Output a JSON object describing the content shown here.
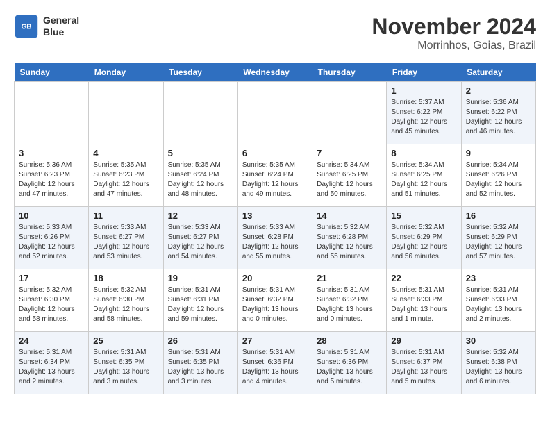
{
  "logo": {
    "line1": "General",
    "line2": "Blue"
  },
  "title": "November 2024",
  "location": "Morrinhos, Goias, Brazil",
  "weekdays": [
    "Sunday",
    "Monday",
    "Tuesday",
    "Wednesday",
    "Thursday",
    "Friday",
    "Saturday"
  ],
  "weeks": [
    [
      {
        "day": "",
        "info": ""
      },
      {
        "day": "",
        "info": ""
      },
      {
        "day": "",
        "info": ""
      },
      {
        "day": "",
        "info": ""
      },
      {
        "day": "",
        "info": ""
      },
      {
        "day": "1",
        "info": "Sunrise: 5:37 AM\nSunset: 6:22 PM\nDaylight: 12 hours and 45 minutes."
      },
      {
        "day": "2",
        "info": "Sunrise: 5:36 AM\nSunset: 6:22 PM\nDaylight: 12 hours and 46 minutes."
      }
    ],
    [
      {
        "day": "3",
        "info": "Sunrise: 5:36 AM\nSunset: 6:23 PM\nDaylight: 12 hours and 47 minutes."
      },
      {
        "day": "4",
        "info": "Sunrise: 5:35 AM\nSunset: 6:23 PM\nDaylight: 12 hours and 47 minutes."
      },
      {
        "day": "5",
        "info": "Sunrise: 5:35 AM\nSunset: 6:24 PM\nDaylight: 12 hours and 48 minutes."
      },
      {
        "day": "6",
        "info": "Sunrise: 5:35 AM\nSunset: 6:24 PM\nDaylight: 12 hours and 49 minutes."
      },
      {
        "day": "7",
        "info": "Sunrise: 5:34 AM\nSunset: 6:25 PM\nDaylight: 12 hours and 50 minutes."
      },
      {
        "day": "8",
        "info": "Sunrise: 5:34 AM\nSunset: 6:25 PM\nDaylight: 12 hours and 51 minutes."
      },
      {
        "day": "9",
        "info": "Sunrise: 5:34 AM\nSunset: 6:26 PM\nDaylight: 12 hours and 52 minutes."
      }
    ],
    [
      {
        "day": "10",
        "info": "Sunrise: 5:33 AM\nSunset: 6:26 PM\nDaylight: 12 hours and 52 minutes."
      },
      {
        "day": "11",
        "info": "Sunrise: 5:33 AM\nSunset: 6:27 PM\nDaylight: 12 hours and 53 minutes."
      },
      {
        "day": "12",
        "info": "Sunrise: 5:33 AM\nSunset: 6:27 PM\nDaylight: 12 hours and 54 minutes."
      },
      {
        "day": "13",
        "info": "Sunrise: 5:33 AM\nSunset: 6:28 PM\nDaylight: 12 hours and 55 minutes."
      },
      {
        "day": "14",
        "info": "Sunrise: 5:32 AM\nSunset: 6:28 PM\nDaylight: 12 hours and 55 minutes."
      },
      {
        "day": "15",
        "info": "Sunrise: 5:32 AM\nSunset: 6:29 PM\nDaylight: 12 hours and 56 minutes."
      },
      {
        "day": "16",
        "info": "Sunrise: 5:32 AM\nSunset: 6:29 PM\nDaylight: 12 hours and 57 minutes."
      }
    ],
    [
      {
        "day": "17",
        "info": "Sunrise: 5:32 AM\nSunset: 6:30 PM\nDaylight: 12 hours and 58 minutes."
      },
      {
        "day": "18",
        "info": "Sunrise: 5:32 AM\nSunset: 6:30 PM\nDaylight: 12 hours and 58 minutes."
      },
      {
        "day": "19",
        "info": "Sunrise: 5:31 AM\nSunset: 6:31 PM\nDaylight: 12 hours and 59 minutes."
      },
      {
        "day": "20",
        "info": "Sunrise: 5:31 AM\nSunset: 6:32 PM\nDaylight: 13 hours and 0 minutes."
      },
      {
        "day": "21",
        "info": "Sunrise: 5:31 AM\nSunset: 6:32 PM\nDaylight: 13 hours and 0 minutes."
      },
      {
        "day": "22",
        "info": "Sunrise: 5:31 AM\nSunset: 6:33 PM\nDaylight: 13 hours and 1 minute."
      },
      {
        "day": "23",
        "info": "Sunrise: 5:31 AM\nSunset: 6:33 PM\nDaylight: 13 hours and 2 minutes."
      }
    ],
    [
      {
        "day": "24",
        "info": "Sunrise: 5:31 AM\nSunset: 6:34 PM\nDaylight: 13 hours and 2 minutes."
      },
      {
        "day": "25",
        "info": "Sunrise: 5:31 AM\nSunset: 6:35 PM\nDaylight: 13 hours and 3 minutes."
      },
      {
        "day": "26",
        "info": "Sunrise: 5:31 AM\nSunset: 6:35 PM\nDaylight: 13 hours and 3 minutes."
      },
      {
        "day": "27",
        "info": "Sunrise: 5:31 AM\nSunset: 6:36 PM\nDaylight: 13 hours and 4 minutes."
      },
      {
        "day": "28",
        "info": "Sunrise: 5:31 AM\nSunset: 6:36 PM\nDaylight: 13 hours and 5 minutes."
      },
      {
        "day": "29",
        "info": "Sunrise: 5:31 AM\nSunset: 6:37 PM\nDaylight: 13 hours and 5 minutes."
      },
      {
        "day": "30",
        "info": "Sunrise: 5:32 AM\nSunset: 6:38 PM\nDaylight: 13 hours and 6 minutes."
      }
    ]
  ]
}
